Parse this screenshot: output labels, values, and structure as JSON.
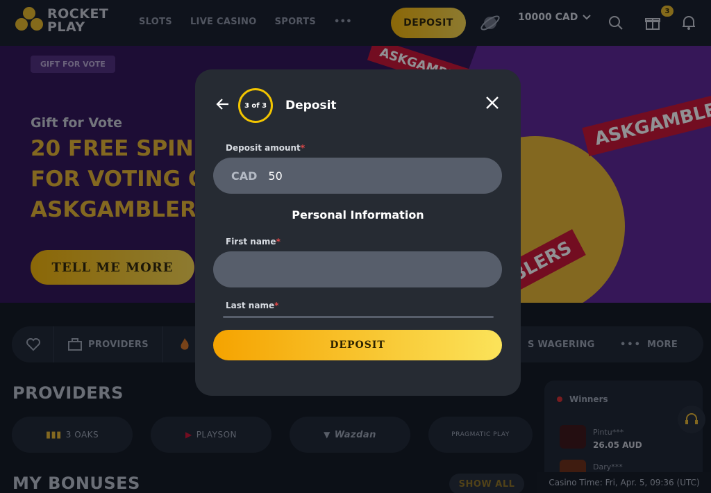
{
  "header": {
    "logo_line1": "ROCKET",
    "logo_line2": "PLAY",
    "nav": [
      "SLOTS",
      "LIVE CASINO",
      "SPORTS",
      "•••"
    ],
    "deposit_label": "DEPOSIT",
    "balance": "10000 CAD",
    "gift_badge": "3",
    "accent": "#f2c500"
  },
  "banner": {
    "tag": "GIFT FOR VOTE",
    "subtitle": "Gift for Vote",
    "headline": [
      "20 FREE SPIN",
      "FOR VOTING O",
      "ASKGAMBLER"
    ],
    "cta": "TELL ME MORE",
    "brand_labels": [
      "ASKGAMBLER",
      "ASKGAMBLERS",
      "BLERS"
    ]
  },
  "filterbar": {
    "providers": "PROVIDERS",
    "wagering": "S WAGERING",
    "more": "MORE"
  },
  "sections": {
    "providers_title": "PROVIDERS",
    "bonuses_title": "MY BONUSES",
    "show_all": "SHOW ALL",
    "provider_names": [
      "3 OAKS",
      "PLAYSON",
      "Wazdan",
      "PRAGMATIC PLAY"
    ]
  },
  "winners": {
    "title": "Winners",
    "items": [
      {
        "name": "Pintu***",
        "amount": "26.05 AUD"
      },
      {
        "name": "Dary***",
        "amount": ""
      }
    ]
  },
  "casino_time": "Casino Time: Fri, Apr. 5, 09:36 (UTC)",
  "modal": {
    "step": "3 of 3",
    "title": "Deposit",
    "amount_label": "Deposit amount",
    "currency": "CAD",
    "amount_value": "50",
    "section_title": "Personal Information",
    "first_name_label": "First name",
    "first_name_value": "",
    "last_name_label": "Last name",
    "submit_label": "DEPOSIT",
    "required_mark": "*"
  }
}
